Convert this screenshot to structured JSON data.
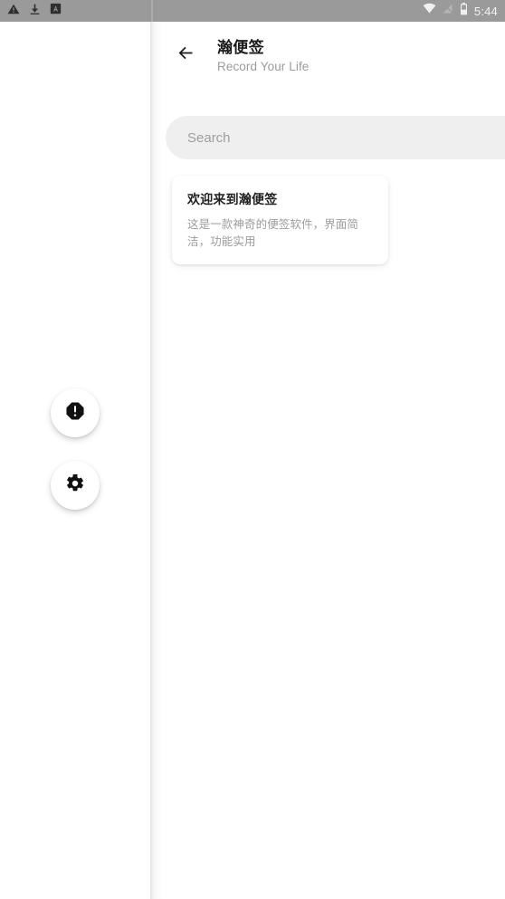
{
  "status_bar": {
    "background": "#9a9a9a",
    "left_icons": [
      {
        "name": "warning-triangle-icon",
        "glyph": "warning"
      },
      {
        "name": "download-icon",
        "glyph": "download"
      },
      {
        "name": "adb-icon",
        "glyph": "adb"
      }
    ],
    "right_icons": [
      {
        "name": "wifi-icon",
        "glyph": "wifi"
      },
      {
        "name": "cellular-signal-icon",
        "glyph": "signal"
      },
      {
        "name": "battery-icon",
        "glyph": "battery"
      }
    ],
    "clock": "5:44"
  },
  "host_panel": {
    "fabs": [
      {
        "name": "alert-fab",
        "icon": "alert-octagon-icon",
        "label": ""
      },
      {
        "name": "settings-fab",
        "icon": "gear-icon",
        "label": ""
      }
    ]
  },
  "app": {
    "appbar": {
      "back_icon": "arrow-left-icon",
      "title": "瀚便签",
      "subtitle": "Record Your Life"
    },
    "search": {
      "placeholder": "Search",
      "value": ""
    },
    "notes": [
      {
        "title": "欢迎来到瀚便签",
        "body": "这是一款神奇的便签软件，界面简洁，功能实用"
      }
    ]
  },
  "colors": {
    "status_bar": "#9a9a9a",
    "page_background": "#ffffff",
    "search_background": "#efefef",
    "title_text": "#1b1b1b",
    "muted_text": "#9b9b9b"
  }
}
